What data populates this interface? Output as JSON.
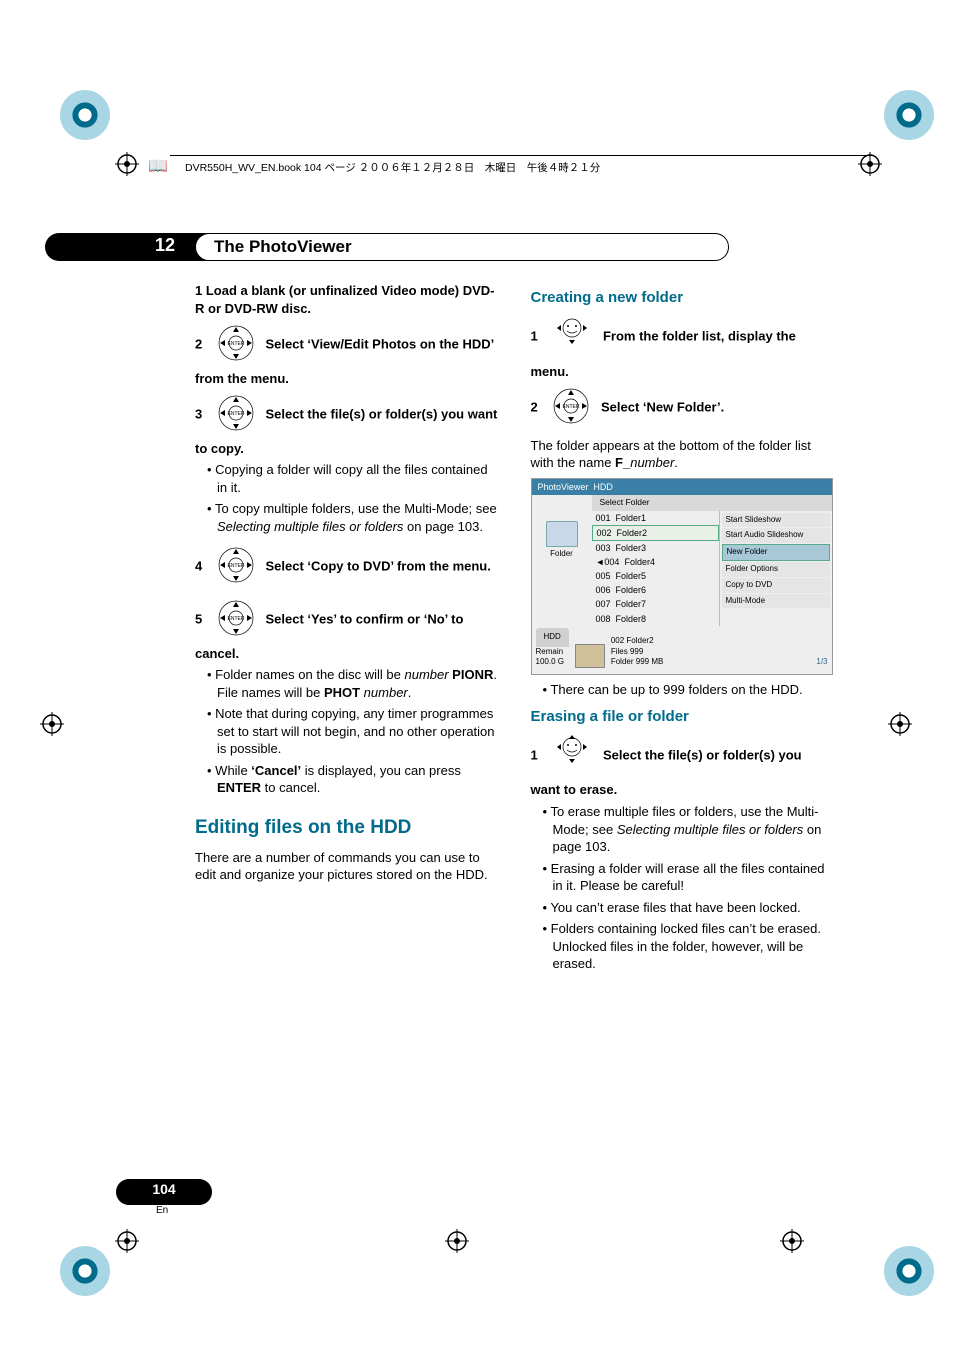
{
  "header": {
    "line": "DVR550H_WV_EN.book 104 ページ ２００６年１２月２８日　木曜日　午後４時２１分"
  },
  "chapter": {
    "number": "12",
    "title": "The PhotoViewer"
  },
  "left": {
    "step1": "1   Load a blank (or unfinalized Video mode) DVD-R or DVD-RW disc.",
    "step2_pre": "2",
    "step2_post": "Select ‘View/Edit Photos on the HDD’ from the menu.",
    "step3_pre": "3",
    "step3_post": "Select the file(s) or folder(s) you want to copy.",
    "b3a": "Copying a folder will copy all the files contained in it.",
    "b3b_a": "To copy multiple folders, use the Multi-Mode; see ",
    "b3b_i": "Selecting multiple files or folders",
    "b3b_c": " on page 103.",
    "step4_pre": "4",
    "step4_post": "Select ‘Copy to DVD’ from the menu.",
    "step5_pre": "5",
    "step5_post": "Select ‘Yes’ to confirm or ‘No’ to cancel.",
    "b5a_a": "Folder names on the disc will be ",
    "b5a_i": "number",
    "b5a_b": " PIONR",
    "b5a_c": ". File names will be ",
    "b5a_d": "PHOT",
    "b5a_e": " number",
    "b5a_f": ".",
    "b5b": "Note that during copying, any timer programmes set to start will not begin, and no other operation is possible.",
    "b5c_a": "While ",
    "b5c_b": "‘Cancel’",
    "b5c_c": " is displayed, you can press ",
    "b5c_d": "ENTER",
    "b5c_e": " to cancel.",
    "sect": "Editing files on the HDD",
    "para": "There are a number of commands you can use to edit and organize your pictures stored on the HDD."
  },
  "right": {
    "sub1": "Creating a new folder",
    "s1_pre": "1",
    "s1_post": "From the folder list, display the menu.",
    "s2_pre": "2",
    "s2_post": "Select ‘New Folder’.",
    "s2_para_a": "The folder appears at the bottom of the folder list with the name ",
    "s2_para_b": "F_",
    "s2_para_c": "number",
    "s2_para_d": ".",
    "pv": {
      "title": "PhotoViewer",
      "device": "HDD",
      "selectbar": "Select Folder",
      "folder_label": "Folder",
      "rows": [
        {
          "n": "001",
          "name": "Folder1"
        },
        {
          "n": "002",
          "name": "Folder2"
        },
        {
          "n": "003",
          "name": "Folder3"
        },
        {
          "n": "004",
          "name": "Folder4"
        },
        {
          "n": "005",
          "name": "Folder5"
        },
        {
          "n": "006",
          "name": "Folder6"
        },
        {
          "n": "007",
          "name": "Folder7"
        },
        {
          "n": "008",
          "name": "Folder8"
        }
      ],
      "menu": [
        "Start Slideshow",
        "Start Audio Slideshow",
        "New Folder",
        "Folder Options",
        "Copy to DVD",
        "Multi-Mode"
      ],
      "hdd": "HDD",
      "remain": "Remain",
      "remain_val": "100.0 G",
      "info_fold": "002  Folder2",
      "info_files": "Files        999",
      "info_folder": "Folder    999 MB",
      "page": "1/3"
    },
    "b_after_pv": "There can be up to 999 folders on the HDD.",
    "sub2": "Erasing a file or folder",
    "e1_pre": "1",
    "e1_post": "Select the file(s) or folder(s) you want to erase.",
    "eb1_a": "To erase multiple files or folders, use the Multi-Mode; see ",
    "eb1_i": "Selecting multiple files or folders",
    "eb1_c": " on page 103.",
    "eb2": "Erasing a folder will erase all the files contained in it. Please be careful!",
    "eb3": "You can’t erase files that have been locked.",
    "eb4": "Folders containing locked files can’t be erased. Unlocked files in the folder, however, will be erased."
  },
  "page": {
    "num": "104",
    "lang": "En"
  }
}
